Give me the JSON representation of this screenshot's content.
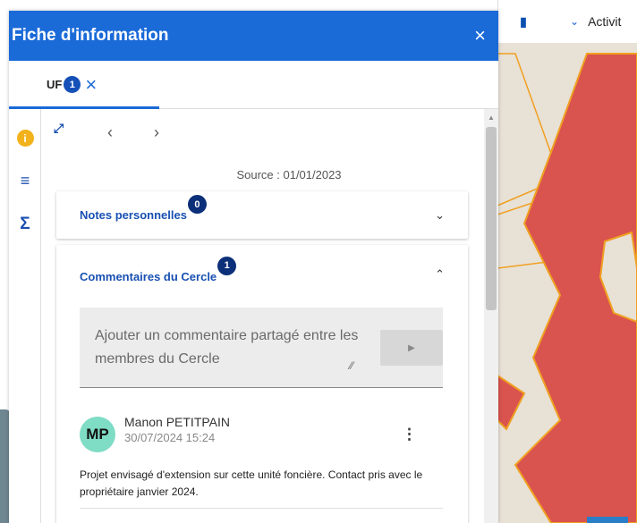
{
  "panel": {
    "title": "Fiche d'information",
    "close_icon": "×"
  },
  "tabs": [
    {
      "label": "UF",
      "badge": "1",
      "close_icon": "×"
    }
  ],
  "nav": {
    "expand_icon": "⤢",
    "prev_icon": "‹",
    "next_icon": "›",
    "source": "Source : 01/01/2023"
  },
  "rail": {
    "info_icon": "i",
    "list_icon": "≡",
    "sigma_icon": "Σ"
  },
  "notes": {
    "title": "Notes personnelles",
    "count": "0",
    "chevron": "⌄"
  },
  "comments": {
    "title": "Commentaires du Cercle",
    "count": "1",
    "chevron": "⌃",
    "placeholder": "Ajouter un commentaire partagé entre les membres du Cercle",
    "send_icon": "▶",
    "items": [
      {
        "initials": "MP",
        "author": "Manon PETITPAIN",
        "date": "30/07/2024 15:24",
        "text": "Projet envisagé d'extension sur cette unité foncière. Contact pris avec le propriétaire janvier 2024."
      }
    ]
  },
  "map": {
    "layer_label": "Activit",
    "colors": {
      "parcel_fill": "#d9534f",
      "parcel_border": "#f0a020",
      "background": "#e8e1d6"
    }
  },
  "colors": {
    "accent": "#1a6ad8",
    "badge_dark": "#0b2f78",
    "avatar": "#7fdcc5",
    "info": "#f2b21b"
  }
}
